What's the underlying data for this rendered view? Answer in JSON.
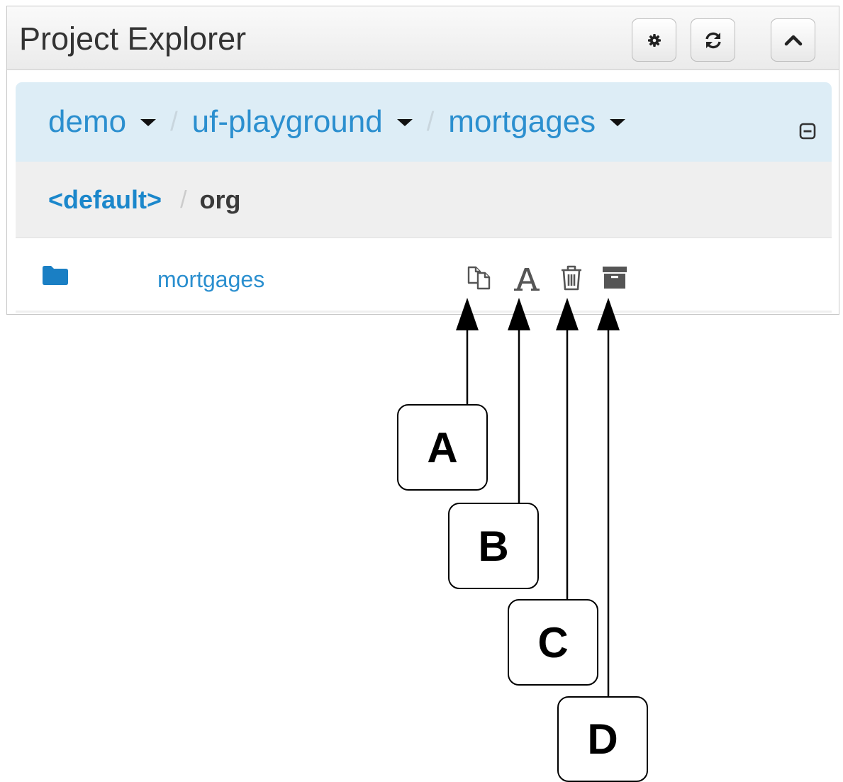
{
  "panel": {
    "title": "Project Explorer",
    "buttons": [
      {
        "name": "settings",
        "icon": "gear-icon"
      },
      {
        "name": "refresh",
        "icon": "refresh-icon"
      },
      {
        "name": "collapse-panel",
        "icon": "chevron-up-icon"
      }
    ]
  },
  "repo_breadcrumb": {
    "items": [
      {
        "label": "demo",
        "has_dropdown": true
      },
      {
        "label": "uf-playground",
        "has_dropdown": true
      },
      {
        "label": "mortgages",
        "has_dropdown": true
      }
    ],
    "separator": "/",
    "collapse_icon": "minus-square-icon"
  },
  "path_breadcrumb": {
    "root": "<default>",
    "separator": "/",
    "current": "org"
  },
  "items": [
    {
      "name": "mortgages",
      "icon": "folder-icon",
      "actions": [
        "copy-icon",
        "rename-icon",
        "delete-icon",
        "archive-icon"
      ]
    }
  ],
  "callouts": {
    "a": "A",
    "b": "B",
    "c": "C",
    "d": "D"
  },
  "colors": {
    "link": "#2b8fcf",
    "repo_bar_bg": "#ddedf6",
    "path_bar_bg": "#efefef",
    "icon_gray": "#555555"
  }
}
